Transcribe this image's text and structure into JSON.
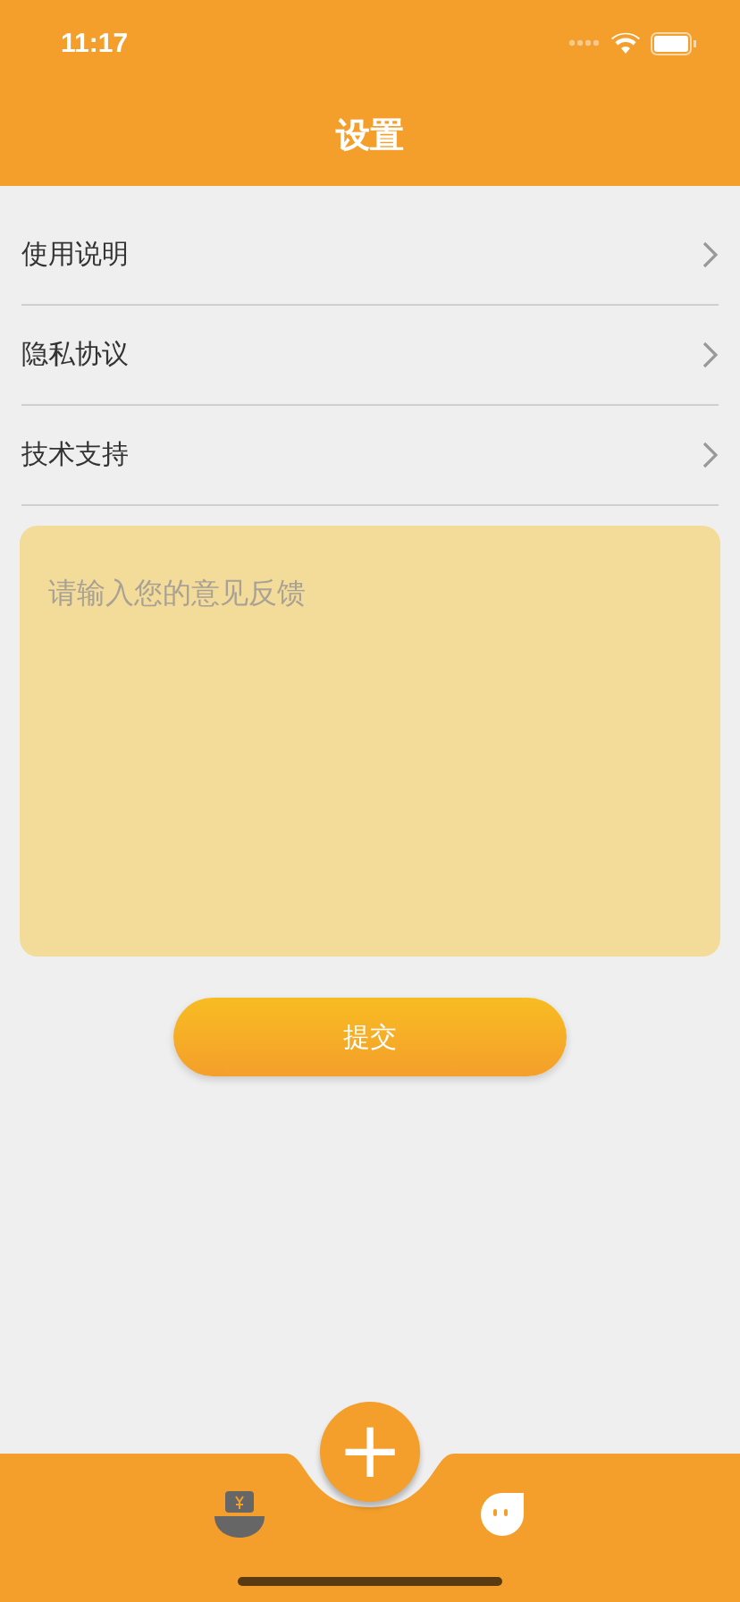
{
  "status_bar": {
    "time": "11:17"
  },
  "header": {
    "title": "设置"
  },
  "menu": [
    {
      "label": "使用说明"
    },
    {
      "label": "隐私协议"
    },
    {
      "label": "技术支持"
    }
  ],
  "feedback": {
    "placeholder": "请输入您的意见反馈"
  },
  "submit_button": "提交",
  "tab_bar": {
    "center_button": "+"
  }
}
